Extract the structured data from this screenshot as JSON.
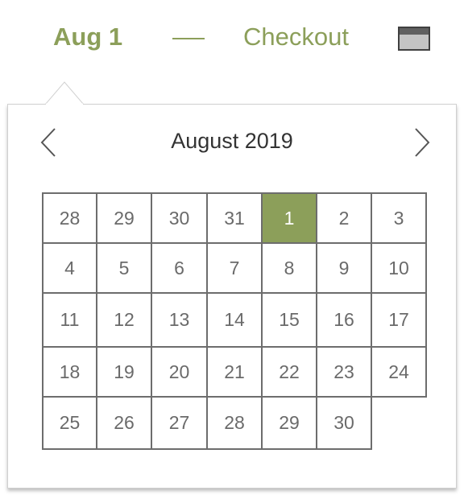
{
  "header": {
    "checkin_label": "Aug 1",
    "checkout_label": "Checkout",
    "calendar_icon": "calendar-icon"
  },
  "calendar": {
    "month_title": "August 2019",
    "prev_icon": "chevron-left-icon",
    "next_icon": "chevron-right-icon",
    "selected_day": "1",
    "weeks": [
      [
        "28",
        "29",
        "30",
        "31",
        "1",
        "2",
        "3"
      ],
      [
        "4",
        "5",
        "6",
        "7",
        "8",
        "9",
        "10"
      ],
      [
        "11",
        "12",
        "13",
        "14",
        "15",
        "16",
        "17"
      ],
      [
        "18",
        "19",
        "20",
        "21",
        "22",
        "23",
        "24"
      ],
      [
        "25",
        "26",
        "27",
        "28",
        "29",
        "30"
      ]
    ]
  },
  "colors": {
    "accent": "#8c9f5a",
    "grid_border": "#6d6d6d",
    "day_text": "#6a6a6a"
  }
}
